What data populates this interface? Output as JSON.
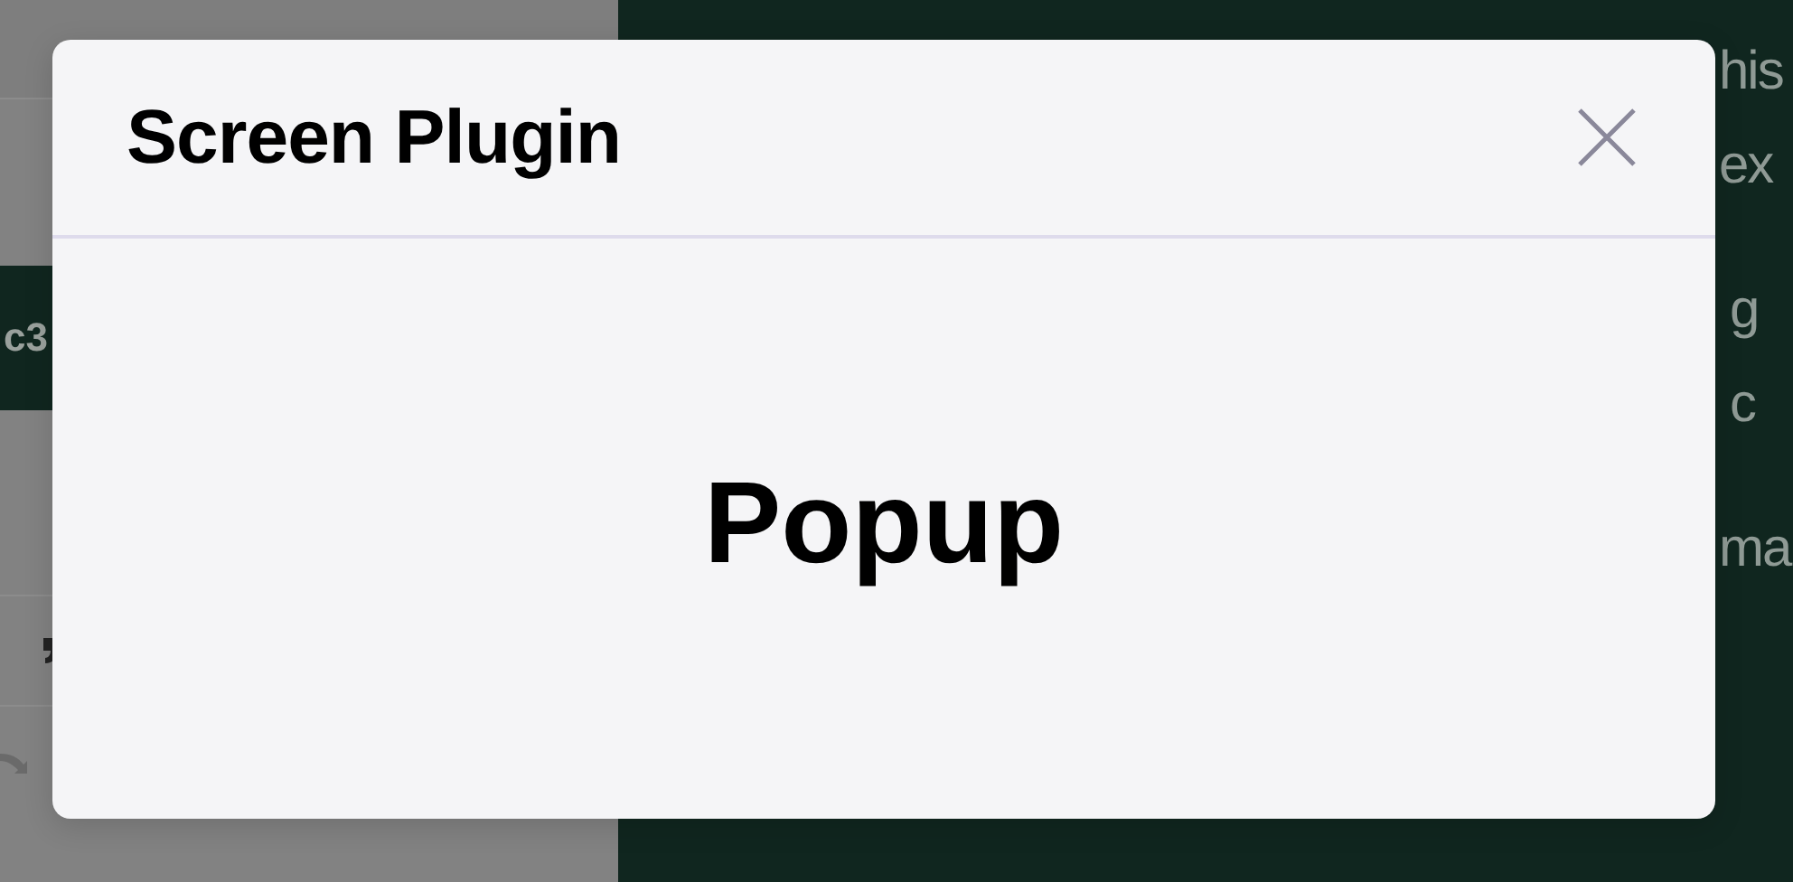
{
  "background": {
    "left_panel": {
      "badge_text": "c3"
    },
    "right_panel": {
      "paragraphs": [
        [
          "his",
          "ex"
        ],
        [
          "g",
          "c"
        ],
        [
          "ma"
        ]
      ]
    }
  },
  "dialog": {
    "title": "Screen Plugin",
    "body": "Popup"
  }
}
